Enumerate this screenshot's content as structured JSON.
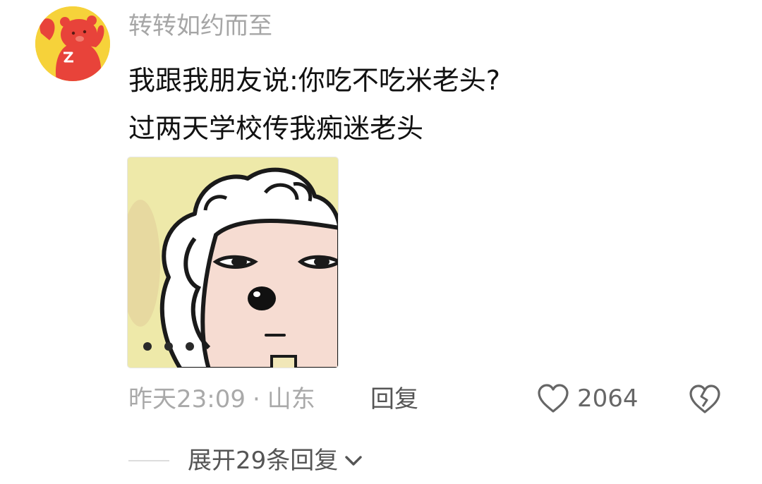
{
  "comment": {
    "username": "转转如约而至",
    "text_lines": [
      "我跟我朋友说:你吃不吃米老头?",
      "过两天学校传我痴迷老头"
    ],
    "time": "昨天23:09",
    "separator": "·",
    "location": "山东",
    "reply_label": "回复",
    "like_count": "2064",
    "expand_label": "展开29条回复"
  },
  "icons": {
    "avatar": "red-beaver-avatar",
    "like": "heart-outline-icon",
    "dislike": "broken-heart-icon",
    "expand": "chevron-down-icon"
  },
  "colors": {
    "username": "#a6a6a6",
    "text": "#111111",
    "meta": "#a9a9a9",
    "action": "#555555",
    "avatar_bg": "#f6d23a",
    "avatar_char": "#e8433a"
  }
}
